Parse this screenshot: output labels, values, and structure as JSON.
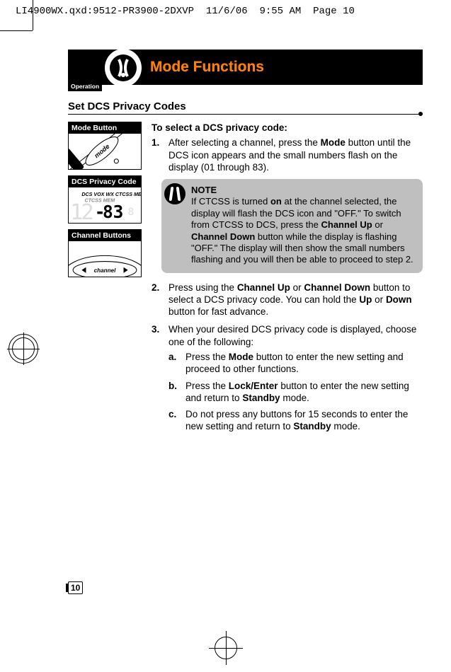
{
  "print_header": "LI4900WX.qxd:9512-PR3900-2DXVP  11/6/06  9:55 AM  Page 10",
  "header": {
    "operation_label": "Operation",
    "title": "Mode Functions"
  },
  "section_title": "Set DCS Privacy Codes",
  "sidebar": {
    "cards": [
      {
        "label": "Mode Button",
        "illus": "mode_button"
      },
      {
        "label": "DCS Privacy Code",
        "illus": "dcs_display"
      },
      {
        "label": "Channel Buttons",
        "illus": "channel_buttons"
      }
    ],
    "display_indicators": "DCS VOX WX CTCSS  MEM",
    "display_value": "83",
    "channel_label": "channel"
  },
  "content": {
    "lead": "To select a DCS privacy code:",
    "steps": [
      {
        "n": "1.",
        "text_parts": [
          "After selecting a channel, press the ",
          "Mode",
          " button until the DCS icon appears and the small numbers flash on the display (01 through 83)."
        ]
      },
      {
        "n": "2.",
        "text_parts": [
          "Press using the ",
          "Channel Up",
          " or ",
          "Channel Down",
          " button to select a DCS privacy code. You can hold the ",
          "Up",
          " or ",
          "Down",
          " button for fast advance."
        ]
      },
      {
        "n": "3.",
        "text_parts": [
          "When your desired DCS privacy code is displayed, choose one of the following:"
        ],
        "sub": [
          {
            "n": "a.",
            "parts": [
              "Press the ",
              "Mode",
              " button to enter the new setting and proceed to other functions."
            ]
          },
          {
            "n": "b.",
            "parts": [
              "Press the ",
              "Lock/Enter",
              " button to enter the new setting and return to ",
              "Standby",
              " mode."
            ]
          },
          {
            "n": "c.",
            "parts": [
              "Do not press any buttons for 15 seconds to enter the new setting and return to ",
              "Standby",
              " mode."
            ]
          }
        ]
      }
    ]
  },
  "note": {
    "title": "NOTE",
    "parts": [
      "If CTCSS is turned ",
      "on",
      " at the channel selected, the display will flash the DCS icon and \"OFF.\" To switch from CTCSS to DCS, press the ",
      "Channel Up",
      " or ",
      "Channel Down",
      " button while the display is flashing \"OFF.\" The display will then show the small numbers flashing and you will then be able to proceed to step 2."
    ]
  },
  "page_number": "10"
}
